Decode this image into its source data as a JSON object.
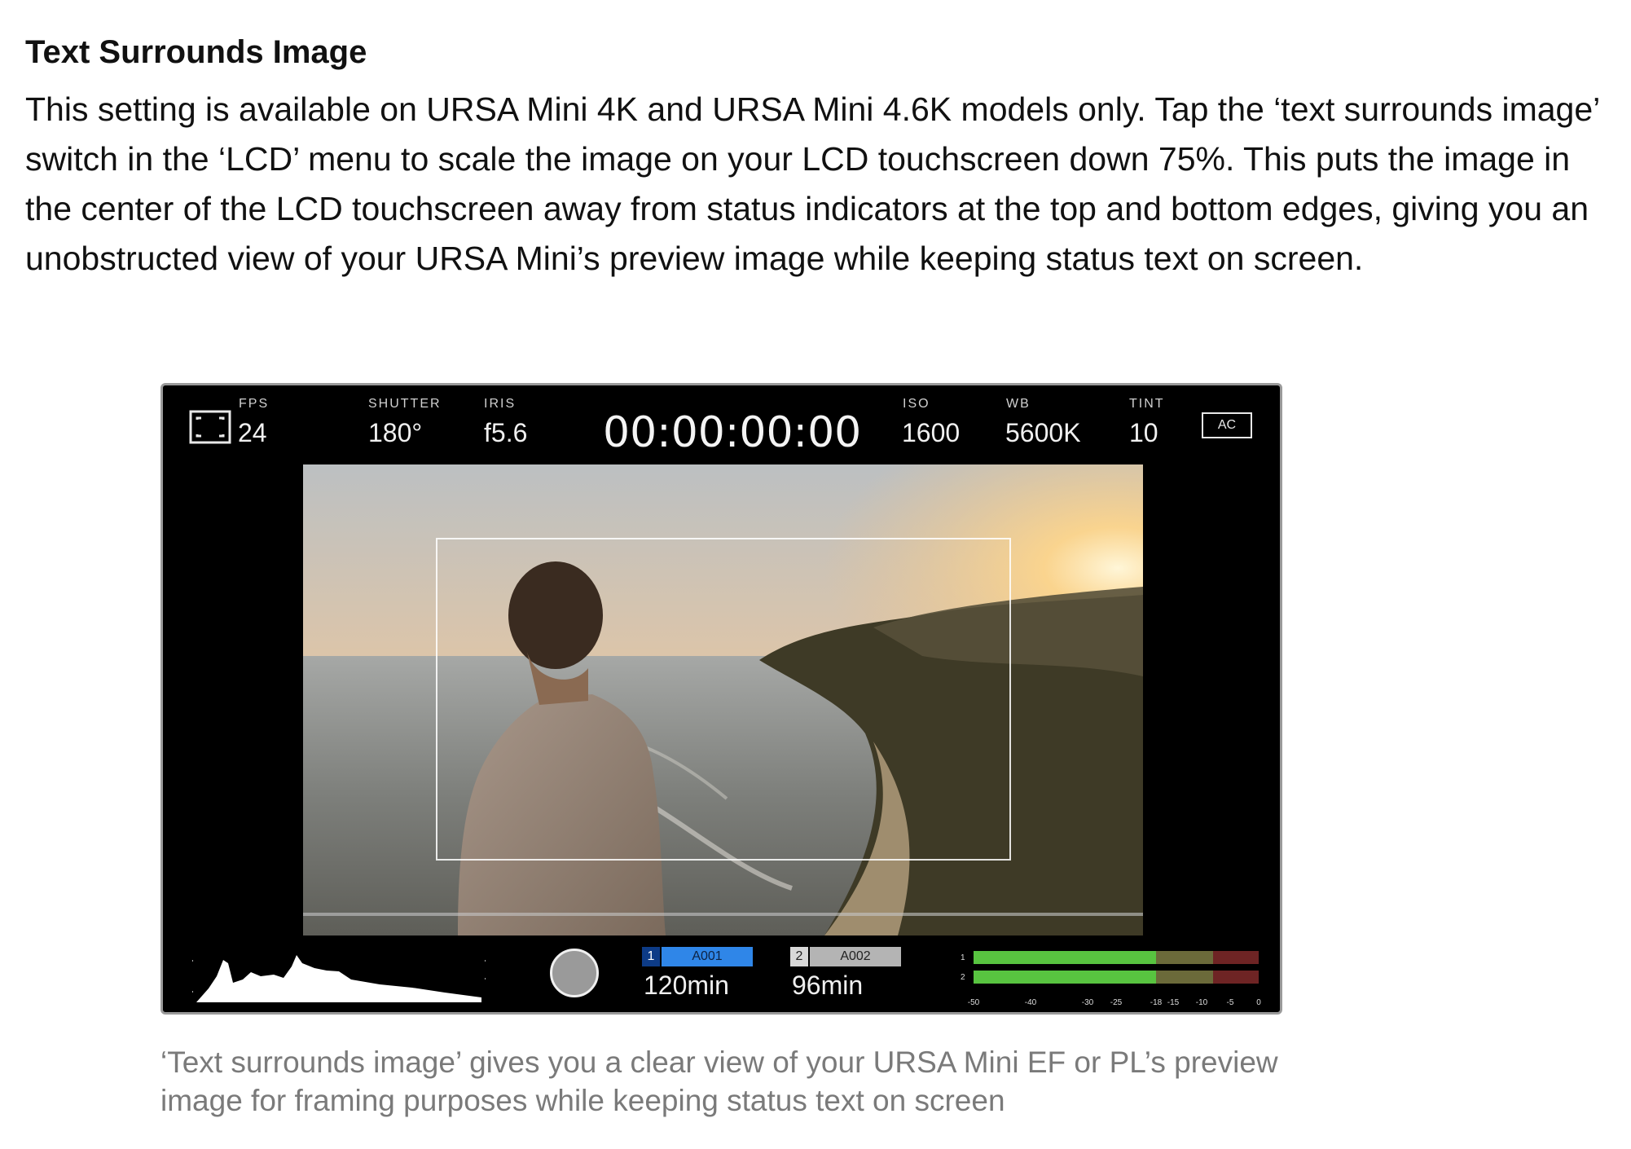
{
  "section": {
    "heading": "Text Surrounds Image",
    "body": "This setting is available on URSA Mini 4K and URSA Mini 4.6K models only. Tap the ‘text surrounds image’ switch in the ‘LCD’ menu to scale the image on your LCD touchscreen down 75%. This puts the image in the center of the LCD touchscreen away from status indicators at the top and bottom edges, giving you an unobstructed view of your URSA Mini’s preview image while keeping status text on screen."
  },
  "lcd": {
    "fps_label": "FPS",
    "fps_value": "24",
    "shutter_label": "SHUTTER",
    "shutter_value": "180°",
    "iris_label": "IRIS",
    "iris_value": "f5.6",
    "timecode": "00:00:00:00",
    "iso_label": "ISO",
    "iso_value": "1600",
    "wb_label": "WB",
    "wb_value": "5600K",
    "tint_label": "TINT",
    "tint_value": "10",
    "ac_badge": "AC",
    "slot1": {
      "number": "1",
      "name": "A001",
      "time": "120min",
      "color": "#2f86e8"
    },
    "slot2": {
      "number": "2",
      "name": "A002",
      "time": "96min",
      "color": "#b4b4b4"
    },
    "meters": {
      "channels": [
        "1",
        "2"
      ],
      "scale": [
        "-50",
        "-40",
        "-30",
        "-25",
        "-18",
        "-15",
        "-10",
        "-5",
        "0"
      ],
      "levels_db": [
        -18,
        -18
      ],
      "green": "#58c440",
      "yellow": "#6b6a3a",
      "red": "#6e2424"
    },
    "icons": {
      "frame": "frame-guides-icon",
      "record": "record-button-icon"
    }
  },
  "caption": {
    "text": "‘Text surrounds image’ gives you a clear view of your URSA Mini EF or PL’s preview image for framing purposes while keeping status text on screen"
  }
}
